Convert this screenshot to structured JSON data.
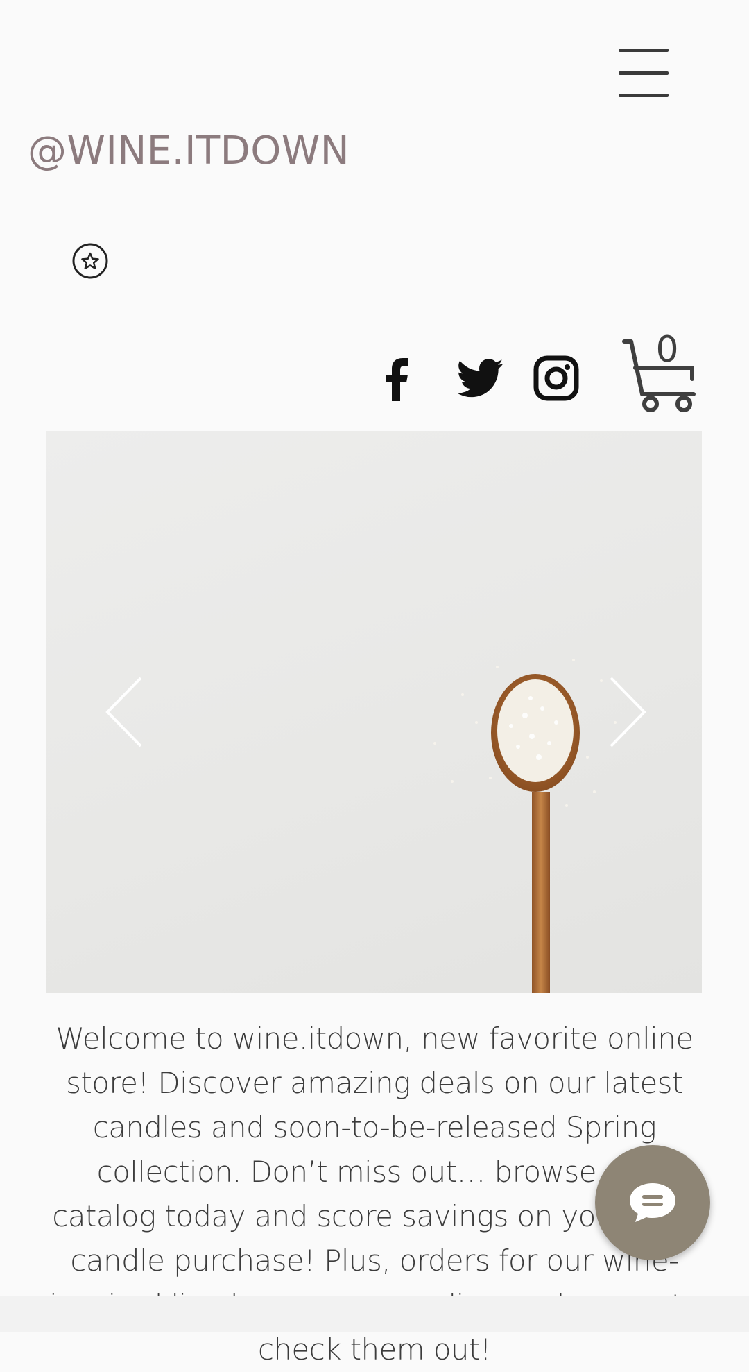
{
  "header": {
    "brand": "@WINE.ITDOWN",
    "menu_icon": "hamburger-menu-icon",
    "badge_icon": "star-badge-icon"
  },
  "social": {
    "items": [
      {
        "name": "Facebook",
        "icon": "facebook-icon"
      },
      {
        "name": "Twitter",
        "icon": "twitter-icon"
      },
      {
        "name": "Instagram",
        "icon": "instagram-icon"
      }
    ]
  },
  "cart": {
    "count": "0",
    "icon": "shopping-cart-icon"
  },
  "hero": {
    "image": "wooden-spoon-with-wax-flakes",
    "prev_icon": "chevron-left-icon",
    "next_icon": "chevron-right-icon"
  },
  "welcome": {
    "text": "Welcome to wine.itdown, new favorite online store! Discover amazing deals on our latest candles and soon-to-be-released Spring collection. Don’t miss out… browse our catalog today and score savings on your next candle purchase! Plus, orders for our wine-inspired lip glosses are now live, so be sure to check them out!"
  },
  "chat": {
    "icon": "chat-bubble-icon"
  },
  "colors": {
    "background": "#fafafa",
    "brand_text": "#8c7b7e",
    "body_text": "#3c3c3c",
    "chat_button": "#8e8575"
  }
}
